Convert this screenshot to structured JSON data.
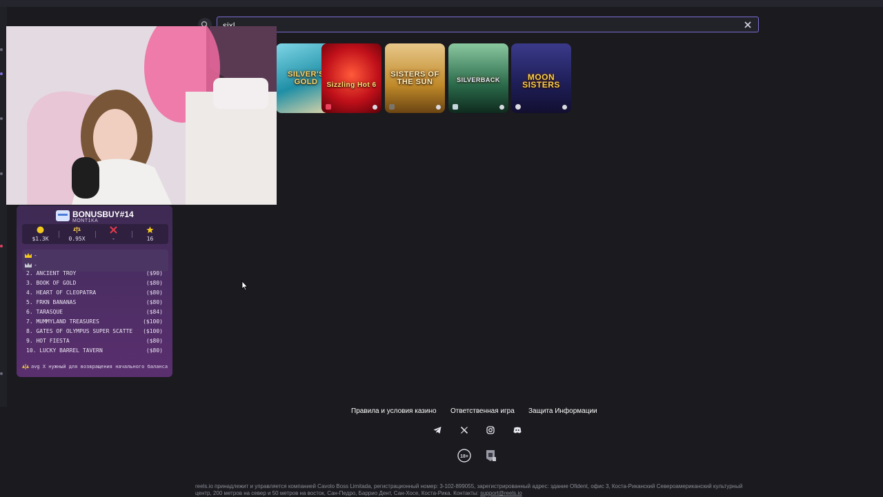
{
  "search": {
    "value": "six|",
    "placeholder": ""
  },
  "games": [
    {
      "title": "SILVER'S GOLD",
      "bg": "#1f8fa6"
    },
    {
      "title": "Sizzling Hot 6",
      "bg": "#c0101a"
    },
    {
      "title": "SISTERS OF THE SUN",
      "bg": "#c08a2a"
    },
    {
      "title": "SILVERBACK",
      "bg": "#2a6a4a"
    },
    {
      "title": "MOON SISTERS",
      "bg": "#1f1f5a"
    }
  ],
  "bonusbuy": {
    "title": "BONUSBUY#14",
    "subtitle": "MONT1KA",
    "stats": [
      "$1.3K",
      "0.95X",
      "-",
      "16"
    ],
    "king_rows": [
      "-",
      "-"
    ],
    "items": [
      {
        "num": "2.",
        "name": "ANCIENT TROY",
        "price": "($90)"
      },
      {
        "num": "3.",
        "name": "BOOK OF GOLD",
        "price": "($80)"
      },
      {
        "num": "4.",
        "name": "HEART OF CLEOPATRA",
        "price": "($80)"
      },
      {
        "num": "5.",
        "name": "FRKN BANANAS",
        "price": "($80)"
      },
      {
        "num": "6.",
        "name": "TARASQUE",
        "price": "($84)"
      },
      {
        "num": "7.",
        "name": "MUMMYLAND TREASURES",
        "price": "($100)"
      },
      {
        "num": "8.",
        "name": "GATES OF OLYMPUS SUPER SCATTE",
        "price": "($100)"
      },
      {
        "num": "9.",
        "name": "HOT FIESTA",
        "price": "($80)"
      },
      {
        "num": "10.",
        "name": "LUCKY BARREL TAVERN",
        "price": "($80)"
      }
    ],
    "footer": "avg X нужный для возвращения начального баланса"
  },
  "footer": {
    "links": [
      "Правила и условия казино",
      "Ответственная игра",
      "Защита Информации"
    ],
    "social": [
      "telegram-icon",
      "x-icon",
      "instagram-icon",
      "discord-icon"
    ],
    "age_badge": "18+",
    "legal_text": "reels.io принадлежит и управляется компанией Cavolo Boss Limitada, регистрационный номер: 3-102-899055, зарегистрированный адрес: здание Ofident, офис 3, Коста-Риканский Североамериканский культурный центр, 200 метров на север и 50 метров на восток, Сан-Педро, Баррио Дент, Сан-Хосе, Коста-Рика. Контакты: ",
    "legal_email": "support@reels.io"
  }
}
